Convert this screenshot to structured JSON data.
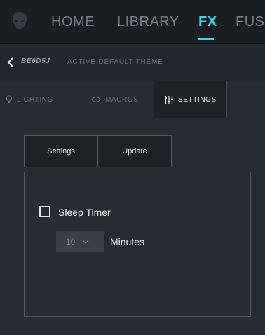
{
  "nav": {
    "items": [
      {
        "label": "HOME"
      },
      {
        "label": "LIBRARY"
      },
      {
        "label": "FX"
      },
      {
        "label": "FUS"
      }
    ],
    "active": "FX"
  },
  "theme": {
    "name": "BE6D5J",
    "status": "ACTIVE DEFAULT THEME"
  },
  "tabs": {
    "lighting": "LIGHTING",
    "macros": "MACROS",
    "settings": "SETTINGS",
    "active": "SETTINGS"
  },
  "buttons": {
    "settings": "Settings",
    "update": "Update"
  },
  "sleep_timer": {
    "label": "Sleep Timer",
    "checked": false,
    "value": "10",
    "unit": "Minutes"
  },
  "colors": {
    "accent": "#3fd2e8",
    "background": "#2a2b30",
    "nav_background": "#1c1d21"
  },
  "icons": [
    "alien-logo-icon",
    "back-chevron-icon",
    "bulb-icon",
    "eye-icon",
    "sliders-icon",
    "chevron-down-icon"
  ]
}
